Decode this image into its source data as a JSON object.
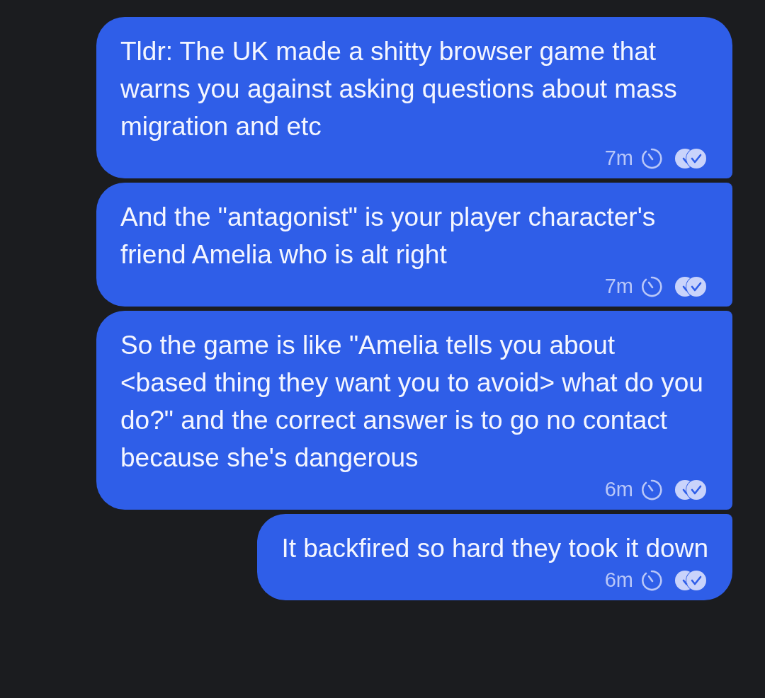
{
  "messages": [
    {
      "text": "Tldr: The UK made a shitty browser game that warns you against asking questions about mass migration and etc",
      "time": "7m"
    },
    {
      "text": "And the \"antagonist\" is your player character's friend Amelia who is alt right",
      "time": "7m"
    },
    {
      "text": "So the game is like \"Amelia tells you about <based thing they want you to avoid> what do you do?\" and the correct answer is to go no contact because she's dangerous",
      "time": "6m"
    },
    {
      "text": "It backfired so hard they took it down",
      "time": "6m"
    }
  ]
}
